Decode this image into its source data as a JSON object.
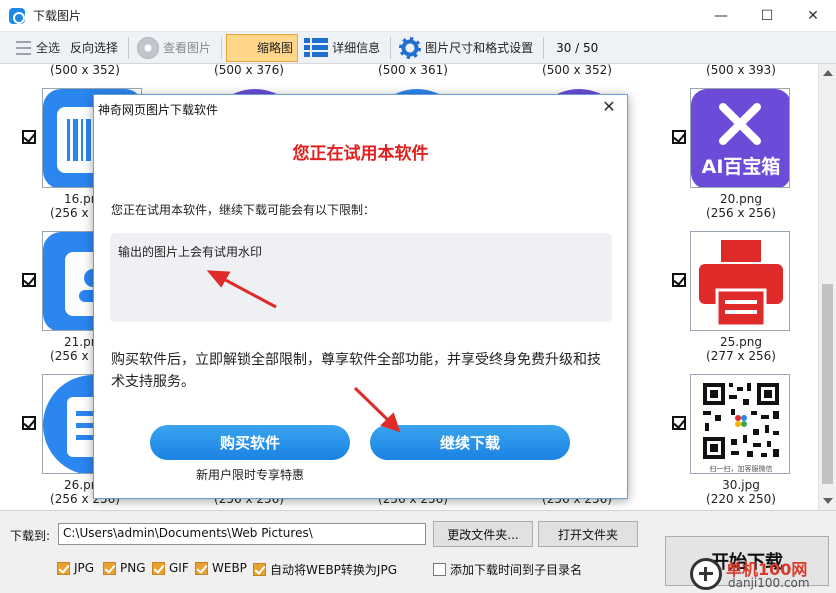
{
  "window": {
    "title": "下载图片",
    "controls": [
      "minimize",
      "maximize",
      "close"
    ]
  },
  "toolbar": {
    "select_all": "全选",
    "invert_select": "反向选择",
    "view_image": "查看图片",
    "thumbnails": "缩略图",
    "details": "详细信息",
    "size_format": "图片尺寸和格式设置",
    "count": "30 / 50"
  },
  "grid": {
    "top_dims": [
      "(500 x 352)",
      "(500 x 376)",
      "(500 x 361)",
      "(500 x 352)",
      "(500 x 393)"
    ],
    "rows": [
      {
        "left": {
          "name": "16.png",
          "dims": "(256 x 256)"
        },
        "right": {
          "name": "20.png",
          "dims": "(256 x 256)"
        }
      },
      {
        "left": {
          "name": "21.png",
          "dims": "(256 x 256)"
        },
        "right": {
          "name": "25.png",
          "dims": "(277 x 256)"
        }
      },
      {
        "left": {
          "name": "26.png",
          "dims": "(256 x 256)"
        },
        "right": {
          "name": "30.jpg",
          "dims": "(220 x 250)"
        }
      }
    ],
    "hidden_bottom_dims": [
      "(256 x 256)",
      "(256 x 256)",
      "(256 x 256)"
    ],
    "thumb_text": {
      "ai": "AI百宝箱",
      "qr_caption": "扫一扫，加客服微信"
    },
    "colors": {
      "blue": "#2b86f0",
      "purple": "#6c4bd8",
      "red": "#e02a2a"
    }
  },
  "bottom": {
    "download_to_label": "下载到:",
    "path": "C:\\Users\\admin\\Documents\\Web Pictures\\",
    "change_folder": "更改文件夹...",
    "open_folder": "打开文件夹",
    "start": "开始下载",
    "options": [
      {
        "label": "JPG",
        "checked": true
      },
      {
        "label": "PNG",
        "checked": true
      },
      {
        "label": "GIF",
        "checked": true
      },
      {
        "label": "WEBP",
        "checked": true
      },
      {
        "label": "自动将WEBP转换为JPG",
        "checked": true
      },
      {
        "label": "添加下载时间到子目录名",
        "checked": false
      }
    ]
  },
  "dialog": {
    "title": "神奇网页图片下载软件",
    "heading": "您正在试用本软件",
    "intro": "您正在试用本软件，继续下载可能会有以下限制：",
    "limitation": "输出的图片上会有试用水印",
    "body": "购买软件后，立即解锁全部限制，尊享软件全部功能，并享受终身免费升级和技术支持服务。",
    "buy": "购买软件",
    "continue": "继续下载",
    "promo": "新用户限时专享特惠"
  },
  "watermark": {
    "text": "单机100网",
    "url": "danji100.com"
  }
}
